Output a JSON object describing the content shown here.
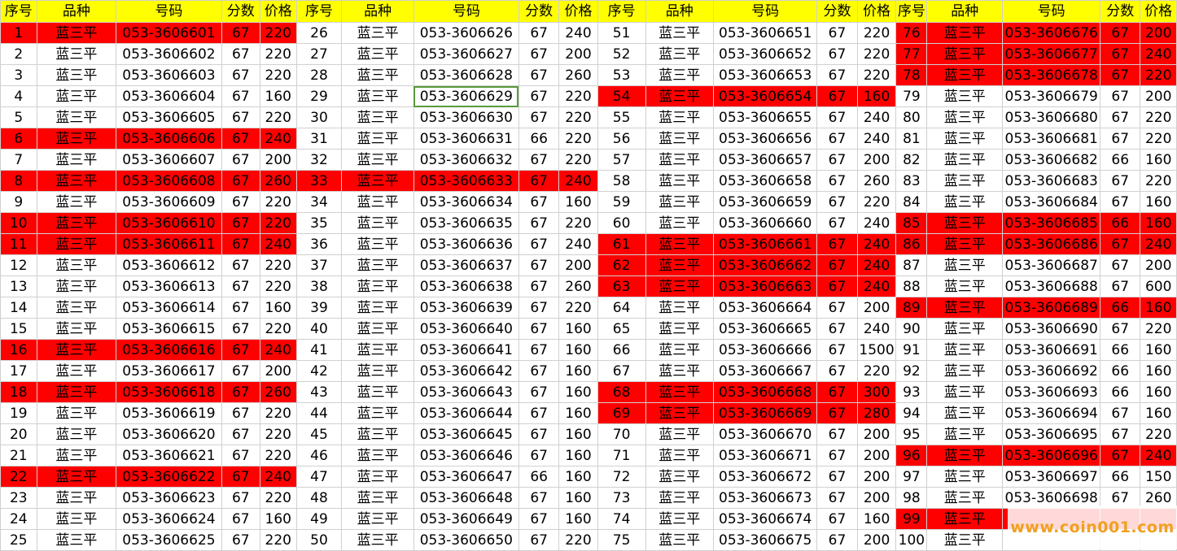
{
  "sheet": {
    "header": [
      "序号",
      "品种",
      "号码",
      "分数",
      "价格"
    ],
    "rows": [
      {
        "no": "1",
        "kind": "蓝三平",
        "code": "053-3606601",
        "score": "67",
        "price": "220"
      },
      {
        "no": "2",
        "kind": "蓝三平",
        "code": "053-3606602",
        "score": "67",
        "price": "220"
      },
      {
        "no": "3",
        "kind": "蓝三平",
        "code": "053-3606603",
        "score": "67",
        "price": "220"
      },
      {
        "no": "4",
        "kind": "蓝三平",
        "code": "053-3606604",
        "score": "67",
        "price": "160"
      },
      {
        "no": "5",
        "kind": "蓝三平",
        "code": "053-3606605",
        "score": "67",
        "price": "220"
      },
      {
        "no": "6",
        "kind": "蓝三平",
        "code": "053-3606606",
        "score": "67",
        "price": "240"
      },
      {
        "no": "7",
        "kind": "蓝三平",
        "code": "053-3606607",
        "score": "67",
        "price": "200"
      },
      {
        "no": "8",
        "kind": "蓝三平",
        "code": "053-3606608",
        "score": "67",
        "price": "260"
      },
      {
        "no": "9",
        "kind": "蓝三平",
        "code": "053-3606609",
        "score": "67",
        "price": "220"
      },
      {
        "no": "10",
        "kind": "蓝三平",
        "code": "053-3606610",
        "score": "67",
        "price": "220"
      },
      {
        "no": "11",
        "kind": "蓝三平",
        "code": "053-3606611",
        "score": "67",
        "price": "240"
      },
      {
        "no": "12",
        "kind": "蓝三平",
        "code": "053-3606612",
        "score": "67",
        "price": "220"
      },
      {
        "no": "13",
        "kind": "蓝三平",
        "code": "053-3606613",
        "score": "67",
        "price": "220"
      },
      {
        "no": "14",
        "kind": "蓝三平",
        "code": "053-3606614",
        "score": "67",
        "price": "160"
      },
      {
        "no": "15",
        "kind": "蓝三平",
        "code": "053-3606615",
        "score": "67",
        "price": "220"
      },
      {
        "no": "16",
        "kind": "蓝三平",
        "code": "053-3606616",
        "score": "67",
        "price": "240"
      },
      {
        "no": "17",
        "kind": "蓝三平",
        "code": "053-3606617",
        "score": "67",
        "price": "200"
      },
      {
        "no": "18",
        "kind": "蓝三平",
        "code": "053-3606618",
        "score": "67",
        "price": "260"
      },
      {
        "no": "19",
        "kind": "蓝三平",
        "code": "053-3606619",
        "score": "67",
        "price": "220"
      },
      {
        "no": "20",
        "kind": "蓝三平",
        "code": "053-3606620",
        "score": "67",
        "price": "220"
      },
      {
        "no": "21",
        "kind": "蓝三平",
        "code": "053-3606621",
        "score": "67",
        "price": "220"
      },
      {
        "no": "22",
        "kind": "蓝三平",
        "code": "053-3606622",
        "score": "67",
        "price": "240"
      },
      {
        "no": "23",
        "kind": "蓝三平",
        "code": "053-3606623",
        "score": "67",
        "price": "220"
      },
      {
        "no": "24",
        "kind": "蓝三平",
        "code": "053-3606624",
        "score": "67",
        "price": "160"
      },
      {
        "no": "25",
        "kind": "蓝三平",
        "code": "053-3606625",
        "score": "67",
        "price": "220"
      },
      {
        "no": "26",
        "kind": "蓝三平",
        "code": "053-3606626",
        "score": "67",
        "price": "240"
      },
      {
        "no": "27",
        "kind": "蓝三平",
        "code": "053-3606627",
        "score": "67",
        "price": "200"
      },
      {
        "no": "28",
        "kind": "蓝三平",
        "code": "053-3606628",
        "score": "67",
        "price": "260"
      },
      {
        "no": "29",
        "kind": "蓝三平",
        "code": "053-3606629",
        "score": "67",
        "price": "220"
      },
      {
        "no": "30",
        "kind": "蓝三平",
        "code": "053-3606630",
        "score": "67",
        "price": "220"
      },
      {
        "no": "31",
        "kind": "蓝三平",
        "code": "053-3606631",
        "score": "66",
        "price": "220"
      },
      {
        "no": "32",
        "kind": "蓝三平",
        "code": "053-3606632",
        "score": "67",
        "price": "220"
      },
      {
        "no": "33",
        "kind": "蓝三平",
        "code": "053-3606633",
        "score": "67",
        "price": "240"
      },
      {
        "no": "34",
        "kind": "蓝三平",
        "code": "053-3606634",
        "score": "67",
        "price": "160"
      },
      {
        "no": "35",
        "kind": "蓝三平",
        "code": "053-3606635",
        "score": "67",
        "price": "220"
      },
      {
        "no": "36",
        "kind": "蓝三平",
        "code": "053-3606636",
        "score": "67",
        "price": "240"
      },
      {
        "no": "37",
        "kind": "蓝三平",
        "code": "053-3606637",
        "score": "67",
        "price": "200"
      },
      {
        "no": "38",
        "kind": "蓝三平",
        "code": "053-3606638",
        "score": "67",
        "price": "260"
      },
      {
        "no": "39",
        "kind": "蓝三平",
        "code": "053-3606639",
        "score": "67",
        "price": "220"
      },
      {
        "no": "40",
        "kind": "蓝三平",
        "code": "053-3606640",
        "score": "67",
        "price": "160"
      },
      {
        "no": "41",
        "kind": "蓝三平",
        "code": "053-3606641",
        "score": "67",
        "price": "160"
      },
      {
        "no": "42",
        "kind": "蓝三平",
        "code": "053-3606642",
        "score": "67",
        "price": "160"
      },
      {
        "no": "43",
        "kind": "蓝三平",
        "code": "053-3606643",
        "score": "67",
        "price": "160"
      },
      {
        "no": "44",
        "kind": "蓝三平",
        "code": "053-3606644",
        "score": "67",
        "price": "160"
      },
      {
        "no": "45",
        "kind": "蓝三平",
        "code": "053-3606645",
        "score": "67",
        "price": "160"
      },
      {
        "no": "46",
        "kind": "蓝三平",
        "code": "053-3606646",
        "score": "67",
        "price": "160"
      },
      {
        "no": "47",
        "kind": "蓝三平",
        "code": "053-3606647",
        "score": "66",
        "price": "160"
      },
      {
        "no": "48",
        "kind": "蓝三平",
        "code": "053-3606648",
        "score": "67",
        "price": "160"
      },
      {
        "no": "49",
        "kind": "蓝三平",
        "code": "053-3606649",
        "score": "67",
        "price": "160"
      },
      {
        "no": "50",
        "kind": "蓝三平",
        "code": "053-3606650",
        "score": "67",
        "price": "220"
      },
      {
        "no": "51",
        "kind": "蓝三平",
        "code": "053-3606651",
        "score": "67",
        "price": "220"
      },
      {
        "no": "52",
        "kind": "蓝三平",
        "code": "053-3606652",
        "score": "67",
        "price": "220"
      },
      {
        "no": "53",
        "kind": "蓝三平",
        "code": "053-3606653",
        "score": "67",
        "price": "220"
      },
      {
        "no": "54",
        "kind": "蓝三平",
        "code": "053-3606654",
        "score": "67",
        "price": "160"
      },
      {
        "no": "55",
        "kind": "蓝三平",
        "code": "053-3606655",
        "score": "67",
        "price": "240"
      },
      {
        "no": "56",
        "kind": "蓝三平",
        "code": "053-3606656",
        "score": "67",
        "price": "240"
      },
      {
        "no": "57",
        "kind": "蓝三平",
        "code": "053-3606657",
        "score": "67",
        "price": "200"
      },
      {
        "no": "58",
        "kind": "蓝三平",
        "code": "053-3606658",
        "score": "67",
        "price": "260"
      },
      {
        "no": "59",
        "kind": "蓝三平",
        "code": "053-3606659",
        "score": "67",
        "price": "220"
      },
      {
        "no": "60",
        "kind": "蓝三平",
        "code": "053-3606660",
        "score": "67",
        "price": "240"
      },
      {
        "no": "61",
        "kind": "蓝三平",
        "code": "053-3606661",
        "score": "67",
        "price": "240"
      },
      {
        "no": "62",
        "kind": "蓝三平",
        "code": "053-3606662",
        "score": "67",
        "price": "240"
      },
      {
        "no": "63",
        "kind": "蓝三平",
        "code": "053-3606663",
        "score": "67",
        "price": "240"
      },
      {
        "no": "64",
        "kind": "蓝三平",
        "code": "053-3606664",
        "score": "67",
        "price": "200"
      },
      {
        "no": "65",
        "kind": "蓝三平",
        "code": "053-3606665",
        "score": "67",
        "price": "240"
      },
      {
        "no": "66",
        "kind": "蓝三平",
        "code": "053-3606666",
        "score": "67",
        "price": "1500"
      },
      {
        "no": "67",
        "kind": "蓝三平",
        "code": "053-3606667",
        "score": "67",
        "price": "220"
      },
      {
        "no": "68",
        "kind": "蓝三平",
        "code": "053-3606668",
        "score": "67",
        "price": "300"
      },
      {
        "no": "69",
        "kind": "蓝三平",
        "code": "053-3606669",
        "score": "67",
        "price": "280"
      },
      {
        "no": "70",
        "kind": "蓝三平",
        "code": "053-3606670",
        "score": "67",
        "price": "200"
      },
      {
        "no": "71",
        "kind": "蓝三平",
        "code": "053-3606671",
        "score": "67",
        "price": "200"
      },
      {
        "no": "72",
        "kind": "蓝三平",
        "code": "053-3606672",
        "score": "67",
        "price": "200"
      },
      {
        "no": "73",
        "kind": "蓝三平",
        "code": "053-3606673",
        "score": "67",
        "price": "200"
      },
      {
        "no": "74",
        "kind": "蓝三平",
        "code": "053-3606674",
        "score": "67",
        "price": "160"
      },
      {
        "no": "75",
        "kind": "蓝三平",
        "code": "053-3606675",
        "score": "67",
        "price": "200"
      },
      {
        "no": "76",
        "kind": "蓝三平",
        "code": "053-3606676",
        "score": "67",
        "price": "200"
      },
      {
        "no": "77",
        "kind": "蓝三平",
        "code": "053-3606677",
        "score": "67",
        "price": "240"
      },
      {
        "no": "78",
        "kind": "蓝三平",
        "code": "053-3606678",
        "score": "67",
        "price": "220"
      },
      {
        "no": "79",
        "kind": "蓝三平",
        "code": "053-3606679",
        "score": "67",
        "price": "200"
      },
      {
        "no": "80",
        "kind": "蓝三平",
        "code": "053-3606680",
        "score": "67",
        "price": "220"
      },
      {
        "no": "81",
        "kind": "蓝三平",
        "code": "053-3606681",
        "score": "67",
        "price": "220"
      },
      {
        "no": "82",
        "kind": "蓝三平",
        "code": "053-3606682",
        "score": "66",
        "price": "160"
      },
      {
        "no": "83",
        "kind": "蓝三平",
        "code": "053-3606683",
        "score": "67",
        "price": "220"
      },
      {
        "no": "84",
        "kind": "蓝三平",
        "code": "053-3606684",
        "score": "67",
        "price": "160"
      },
      {
        "no": "85",
        "kind": "蓝三平",
        "code": "053-3606685",
        "score": "66",
        "price": "160"
      },
      {
        "no": "86",
        "kind": "蓝三平",
        "code": "053-3606686",
        "score": "67",
        "price": "240"
      },
      {
        "no": "87",
        "kind": "蓝三平",
        "code": "053-3606687",
        "score": "67",
        "price": "200"
      },
      {
        "no": "88",
        "kind": "蓝三平",
        "code": "053-3606688",
        "score": "67",
        "price": "600"
      },
      {
        "no": "89",
        "kind": "蓝三平",
        "code": "053-3606689",
        "score": "66",
        "price": "160"
      },
      {
        "no": "90",
        "kind": "蓝三平",
        "code": "053-3606690",
        "score": "67",
        "price": "220"
      },
      {
        "no": "91",
        "kind": "蓝三平",
        "code": "053-3606691",
        "score": "66",
        "price": "160"
      },
      {
        "no": "92",
        "kind": "蓝三平",
        "code": "053-3606692",
        "score": "66",
        "price": "160"
      },
      {
        "no": "93",
        "kind": "蓝三平",
        "code": "053-3606693",
        "score": "66",
        "price": "160"
      },
      {
        "no": "94",
        "kind": "蓝三平",
        "code": "053-3606694",
        "score": "67",
        "price": "160"
      },
      {
        "no": "95",
        "kind": "蓝三平",
        "code": "053-3606695",
        "score": "67",
        "price": "220"
      },
      {
        "no": "96",
        "kind": "蓝三平",
        "code": "053-3606696",
        "score": "67",
        "price": "240"
      },
      {
        "no": "97",
        "kind": "蓝三平",
        "code": "053-3606697",
        "score": "66",
        "price": "150"
      },
      {
        "no": "98",
        "kind": "蓝三平",
        "code": "053-3606698",
        "score": "67",
        "price": "260"
      },
      {
        "no": "99",
        "kind": "蓝三平",
        "code": "",
        "score": "",
        "price": ""
      },
      {
        "no": "100",
        "kind": "蓝三平",
        "code": "",
        "score": "",
        "price": ""
      }
    ],
    "highlighted": [
      1,
      6,
      8,
      10,
      11,
      16,
      18,
      22,
      33,
      54,
      61,
      62,
      63,
      68,
      69,
      76,
      77,
      78,
      85,
      86,
      89,
      96,
      99
    ],
    "selected": 29,
    "highlight_color": "#ff0000",
    "header_color": "#ffff00"
  },
  "watermark": {
    "text": "www.coin001.com"
  }
}
